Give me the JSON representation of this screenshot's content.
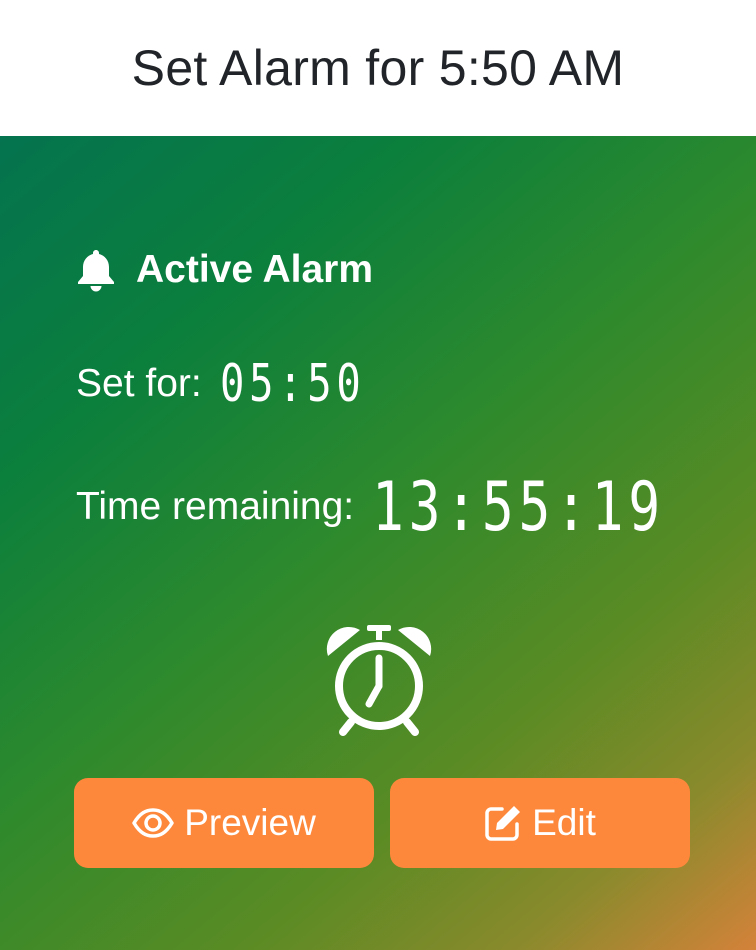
{
  "header": {
    "title": "Set Alarm for 5:50 AM"
  },
  "alarm": {
    "heading": "Active Alarm",
    "set_for_label": "Set for:",
    "set_for_time": "05:50",
    "remaining_label": "Time remaining:",
    "remaining_time": "13:55:19"
  },
  "actions": {
    "preview_label": "Preview",
    "edit_label": "Edit"
  },
  "icons": {
    "heading": "bell-icon",
    "center": "alarm-clock-icon",
    "preview": "eye-icon",
    "edit": "edit-icon"
  },
  "colors": {
    "button": "#fd883b",
    "gradient_start": "#04734f",
    "gradient_end": "#d4823a",
    "header_text": "#212529"
  }
}
